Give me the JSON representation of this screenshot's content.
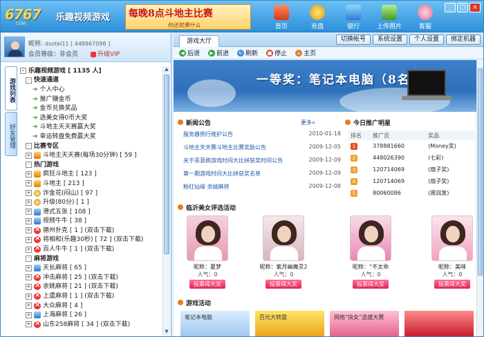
{
  "header": {
    "logo": "6767",
    "logo_sub": "COM",
    "app_title": "乐趣视频游戏",
    "banner_main": "每晚8点斗地主比赛",
    "banner_sub": "你还犹豫什么",
    "nav": [
      {
        "label": "首页",
        "icon": "home-icon"
      },
      {
        "label": "充值",
        "icon": "recharge-icon"
      },
      {
        "label": "银行",
        "icon": "bank-icon"
      },
      {
        "label": "上传照片",
        "icon": "upload-photo-icon"
      },
      {
        "label": "客服",
        "icon": "service-icon"
      }
    ],
    "window_buttons": [
      "_",
      "□",
      "×"
    ]
  },
  "user": {
    "nick_label": "昵称:",
    "nick_value": "dsotel11 [ 448867098 ]",
    "level_text": "会员等级：非会员",
    "upgrade": "升级VIP"
  },
  "left_tabs": [
    "游戏列表",
    "好友管理"
  ],
  "tree": {
    "root": "乐趣视频游戏 [ 1135 人]",
    "items": [
      {
        "level": 0,
        "type": "cat",
        "text": "快速通道"
      },
      {
        "level": 2,
        "type": "link",
        "text": "个人中心"
      },
      {
        "level": 2,
        "type": "link",
        "text": "推广赚金币"
      },
      {
        "level": 2,
        "type": "link",
        "text": "金币兑换奖品"
      },
      {
        "level": 2,
        "type": "link",
        "text": "选美女得0币大奖"
      },
      {
        "level": 2,
        "type": "link",
        "text": "斗地主天天赛赢大奖"
      },
      {
        "level": 2,
        "type": "link",
        "text": "幸运转盘免费赢大奖"
      },
      {
        "level": 0,
        "type": "cat",
        "text": "比赛专区"
      },
      {
        "level": 1,
        "type": "game",
        "icon": "g1",
        "text": "斗地主天天赛(每场30分钟) [ 59 ]"
      },
      {
        "level": 0,
        "type": "cat",
        "text": "热门游戏"
      },
      {
        "level": 1,
        "type": "game",
        "icon": "g1",
        "text": "疯狂斗地主 [ 123 ]"
      },
      {
        "level": 1,
        "type": "game",
        "icon": "g1",
        "text": "斗地主 [ 213 ]"
      },
      {
        "level": 1,
        "type": "game",
        "icon": "g2",
        "text": "诈金花(闷山) [ 97 ]"
      },
      {
        "level": 1,
        "type": "game",
        "icon": "g2",
        "text": "升级(80分) [ 1 ]"
      },
      {
        "level": 1,
        "type": "game",
        "icon": "g3",
        "text": "港式五张 [ 108 ]"
      },
      {
        "level": 1,
        "type": "game",
        "icon": "g3",
        "text": "视频牛牛 [ 38 ]"
      },
      {
        "level": 1,
        "type": "game",
        "icon": "dl",
        "text": "德州扑克 [ 1 ] (双击下载)"
      },
      {
        "level": 1,
        "type": "game",
        "icon": "dl",
        "text": "将相和(乐趣30秒) [ 72 ] (双击下载)"
      },
      {
        "level": 1,
        "type": "game",
        "icon": "dl",
        "text": "百人牛牛 [ 1 ] (双击下载)"
      },
      {
        "level": 0,
        "type": "cat",
        "text": "麻将游戏"
      },
      {
        "level": 1,
        "type": "game",
        "icon": "g3",
        "text": "天长麻将 [ 65 ]"
      },
      {
        "level": 1,
        "type": "game",
        "icon": "dl",
        "text": "冲击麻将 [ 25 ] (双击下载)"
      },
      {
        "level": 1,
        "type": "game",
        "icon": "dl",
        "text": "余姚麻将 [ 21 ] (双击下载)"
      },
      {
        "level": 1,
        "type": "game",
        "icon": "dl",
        "text": "上虞麻将 [ 1 ] (双击下载)"
      },
      {
        "level": 1,
        "type": "game",
        "icon": "dl",
        "text": "大众麻将 [ 4 ]"
      },
      {
        "level": 1,
        "type": "game",
        "icon": "g3",
        "text": "上海麻将 [ 26 ]"
      },
      {
        "level": 1,
        "type": "game",
        "icon": "dl",
        "text": "山东258麻将 [ 34 ] (双击下载)"
      }
    ]
  },
  "right_top": {
    "tab": "游戏大厅",
    "buttons": [
      "切换帐号",
      "系统设置",
      "个人设置",
      "绑定机器"
    ]
  },
  "nav_bar": [
    "后退",
    "前进",
    "刷新",
    "停止",
    "主页"
  ],
  "hero": {
    "text": "一等奖：笔记本电脑（8名）"
  },
  "news": {
    "title": "新闻公告",
    "more": "更多»",
    "items": [
      {
        "title": "服务器例行维护公告",
        "date": "2010-01-18"
      },
      {
        "title": "斗地主天天赛斗地主比赛奖励公告",
        "date": "2009-12-05"
      },
      {
        "title": "关于恶意刷游戏时间大比拼获奖时间公告",
        "date": "2009-12-09"
      },
      {
        "title": "第一期游戏时间大比拼获奖名单",
        "date": "2009-12-09"
      },
      {
        "title": "粉红仙缘 余姚麻将",
        "date": "2009-12-08"
      }
    ]
  },
  "rank": {
    "title": "今日推广明星",
    "headers": [
      "排名",
      "推广员",
      "奖品"
    ],
    "rows": [
      {
        "rank": "1",
        "user": "378881660",
        "prize": "(Money奖)"
      },
      {
        "rank": "2",
        "user": "448026390",
        "prize": "(七彩)"
      },
      {
        "rank": "3",
        "user": "120714069",
        "prize": "(扇子奖)"
      },
      {
        "rank": "4",
        "user": "120714069",
        "prize": "(扇子奖)"
      },
      {
        "rank": "5",
        "user": "80060086",
        "prize": "(周润发)"
      }
    ]
  },
  "beauty": {
    "title": "临沂美女评选活动",
    "cards": [
      {
        "name": "昵称：夏梦",
        "pop": "人气：0",
        "vote": "投票得大奖"
      },
      {
        "name": "昵称：紫月幽魔灵2",
        "pop": "人气：0",
        "vote": "投票得大奖"
      },
      {
        "name": "昵称：“不太乖",
        "pop": "人气：0",
        "vote": "投票得大奖"
      },
      {
        "name": "昵称：美味",
        "pop": "人气：0",
        "vote": "投票得大奖"
      }
    ]
  },
  "activity": {
    "title": "游戏活动",
    "banners": [
      "笔记本电脑",
      "百元大转盘",
      "网络“快女”选拔大赛",
      ""
    ]
  }
}
